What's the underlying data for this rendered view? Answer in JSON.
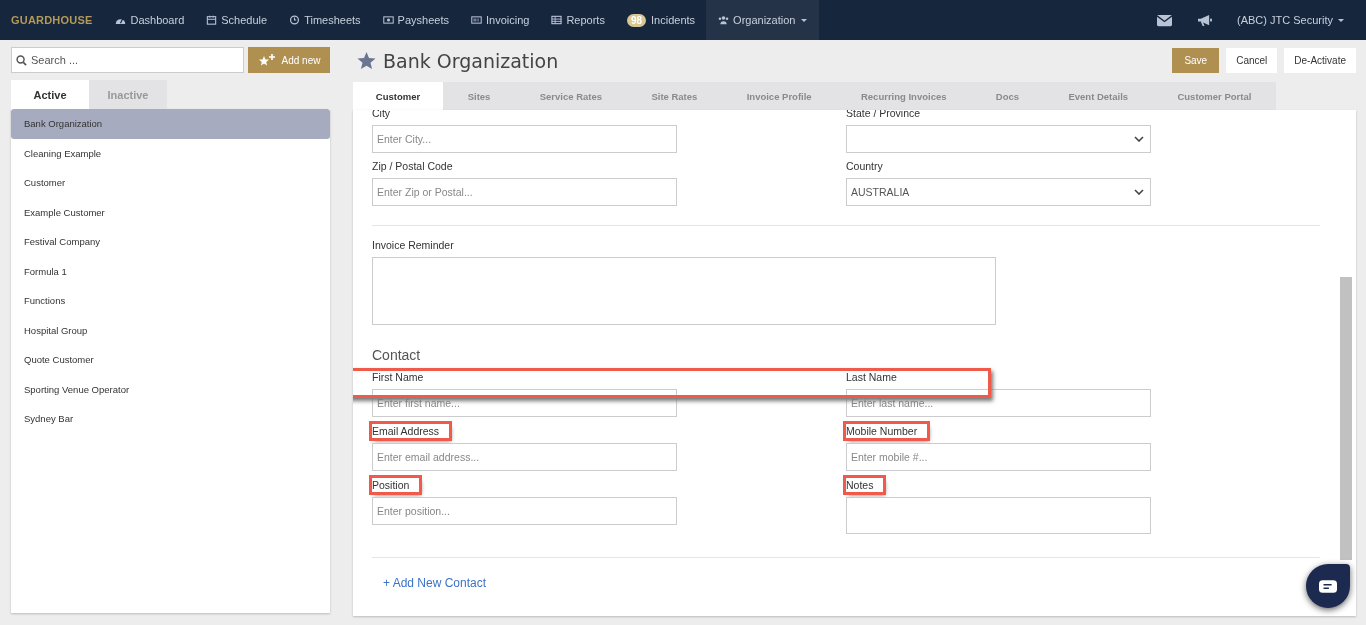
{
  "nav": {
    "brand": "GUARDHOUSE",
    "items": [
      {
        "label": "Dashboard",
        "selected": false
      },
      {
        "label": "Schedule",
        "selected": false
      },
      {
        "label": "Timesheets",
        "selected": false
      },
      {
        "label": "Paysheets",
        "selected": false
      },
      {
        "label": "Invoicing",
        "selected": false
      },
      {
        "label": "Reports",
        "selected": false
      },
      {
        "label": "Incidents",
        "badge": "98",
        "selected": false
      },
      {
        "label": "Organization",
        "selected": true
      }
    ],
    "user": "(ABC) JTC Security"
  },
  "sidebar": {
    "search": {
      "placeholder": "Search ..."
    },
    "add_button": "Add new",
    "tabs": [
      {
        "label": "Active",
        "selected": true
      },
      {
        "label": "Inactive",
        "selected": false
      }
    ],
    "items": [
      {
        "label": "Bank Organization",
        "selected": true
      },
      {
        "label": "Cleaning Example",
        "selected": false
      },
      {
        "label": "Customer",
        "selected": false
      },
      {
        "label": "Example Customer",
        "selected": false
      },
      {
        "label": "Festival Company",
        "selected": false
      },
      {
        "label": "Formula 1",
        "selected": false
      },
      {
        "label": "Functions",
        "selected": false
      },
      {
        "label": "Hospital Group",
        "selected": false
      },
      {
        "label": "Quote Customer",
        "selected": false
      },
      {
        "label": "Sporting Venue Operator",
        "selected": false
      },
      {
        "label": "Sydney Bar",
        "selected": false
      }
    ]
  },
  "page": {
    "title": "Bank Organization",
    "buttons": [
      {
        "label": "Save",
        "kind": "primary"
      },
      {
        "label": "Cancel",
        "kind": "default"
      },
      {
        "label": "De-Activate",
        "kind": "default"
      }
    ],
    "tabs": [
      {
        "label": "Customer",
        "selected": true
      },
      {
        "label": "Sites",
        "selected": false
      },
      {
        "label": "Service Rates",
        "selected": false
      },
      {
        "label": "Site Rates",
        "selected": false
      },
      {
        "label": "Invoice Profile",
        "selected": false
      },
      {
        "label": "Recurring Invoices",
        "selected": false
      },
      {
        "label": "Docs",
        "selected": false
      },
      {
        "label": "Event Details",
        "selected": false
      },
      {
        "label": "Customer Portal",
        "selected": false
      }
    ],
    "address_rows": [
      [
        {
          "label": "City",
          "kind": "text",
          "placeholder": "Enter City..."
        },
        {
          "label": "State / Province",
          "kind": "select"
        }
      ],
      [
        {
          "label": "Zip / Postal Code",
          "kind": "text",
          "placeholder": "Enter Zip or Postal..."
        },
        {
          "label": "Country",
          "kind": "select",
          "value": "AUSTRALIA"
        }
      ]
    ],
    "invoice_reminder": {
      "label": "Invoice Reminder"
    },
    "contact": {
      "heading": "Contact",
      "rows": [
        {
          "highlighted": true,
          "fields": [
            {
              "label": "First Name",
              "kind": "text",
              "placeholder": "Enter first name...",
              "highlighted": false
            },
            {
              "label": "Last Name",
              "kind": "text",
              "placeholder": "Enter last name...",
              "highlighted": false
            }
          ]
        },
        {
          "highlighted": false,
          "fields": [
            {
              "label": "Email Address",
              "kind": "text",
              "placeholder": "Enter email address...",
              "highlighted": true
            },
            {
              "label": "Mobile Number",
              "kind": "text",
              "placeholder": "Enter mobile #...",
              "highlighted": true
            }
          ]
        },
        {
          "highlighted": false,
          "fields": [
            {
              "label": "Position",
              "kind": "text",
              "placeholder": "Enter position...",
              "highlighted": true
            },
            {
              "label": "Notes",
              "kind": "textarea",
              "highlighted": true
            }
          ]
        }
      ],
      "add_link": "+ Add New Contact"
    }
  }
}
